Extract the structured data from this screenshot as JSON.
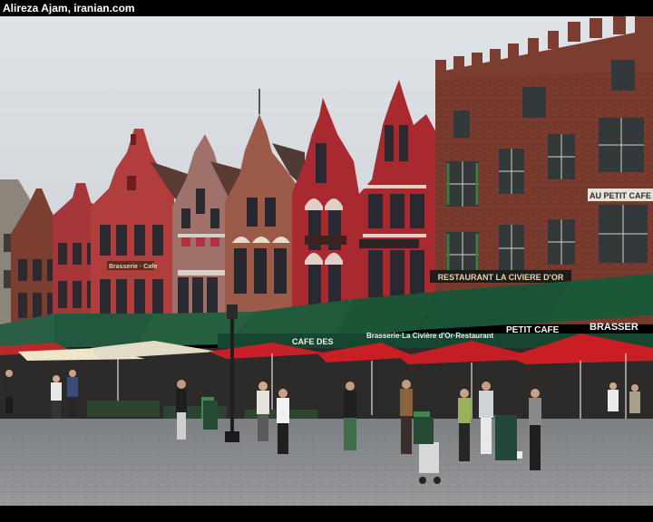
{
  "photo_credit": "Alireza Ajam, iranian.com",
  "signs": {
    "restaurant_top": "RESTAURANT LA CIVIERE D'OR",
    "cafe_des": "CAFE DES",
    "brasserie_civiere": "Brasserie·La Civière d'Or·Restaurant",
    "petit_cafe": "PETIT CAFE",
    "brasserie": "BRASSER",
    "brasserie_cafe": "Brasserie · Cafe",
    "cafe_right": "AU PETIT CAFE"
  },
  "colors": {
    "sky": "#d9dde2",
    "brick": "#7a3b2e",
    "red_facade": "#a6262a",
    "awning_green": "#1f5a3a",
    "umbrella_red": "#c81e24",
    "cobble": "#8d8f92"
  }
}
